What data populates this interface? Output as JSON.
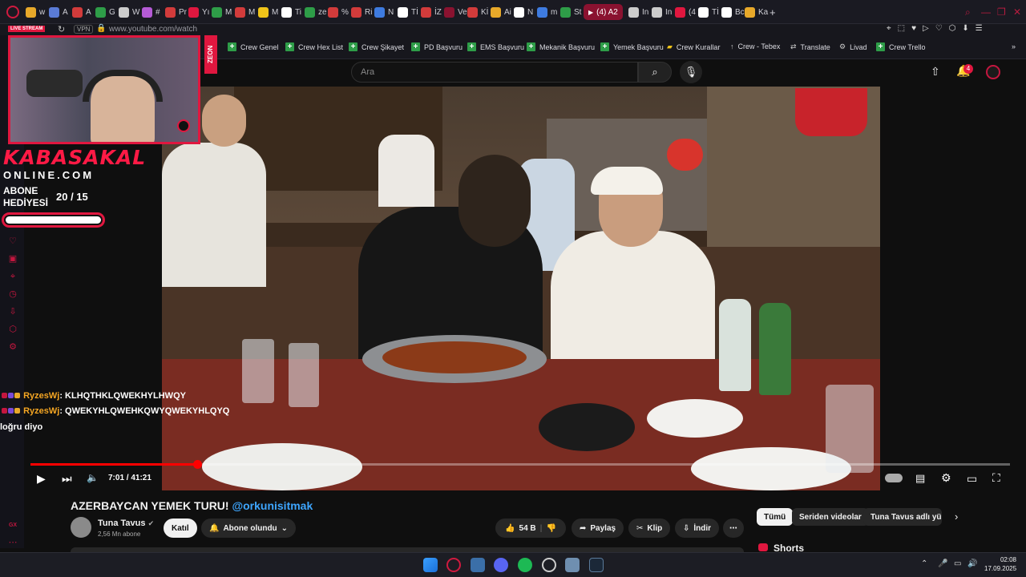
{
  "browser": {
    "tabs": [
      {
        "label": "w",
        "color": "#e8a92a"
      },
      {
        "label": "A",
        "color": "#5a7bd6"
      },
      {
        "label": "A",
        "color": "#d23b3b"
      },
      {
        "label": "G",
        "color": "#2e9d48"
      },
      {
        "label": "W",
        "color": "#cccccc"
      },
      {
        "label": "#",
        "color": "#b55bd6"
      },
      {
        "label": "Pr",
        "color": "#d23b3b"
      },
      {
        "label": "Yı",
        "color": "#e0173f"
      },
      {
        "label": "M",
        "color": "#2e9d48"
      },
      {
        "label": "M",
        "color": "#d23b3b"
      },
      {
        "label": "M",
        "color": "#f0c419"
      },
      {
        "label": "Ti",
        "color": "#ffffff"
      },
      {
        "label": "ze",
        "color": "#2e9d48"
      },
      {
        "label": "%",
        "color": "#d23b3b"
      },
      {
        "label": "Ri",
        "color": "#d23b3b"
      },
      {
        "label": "N",
        "color": "#3e7be0"
      },
      {
        "label": "Tİ",
        "color": "#ffffff"
      },
      {
        "label": "İZ",
        "color": "#d23b3b"
      },
      {
        "label": "Ve",
        "color": "#8a1230"
      },
      {
        "label": "Kİ",
        "color": "#d23b3b"
      },
      {
        "label": "Ai",
        "color": "#e8a92a"
      },
      {
        "label": "N",
        "color": "#ffffff"
      },
      {
        "label": "m",
        "color": "#3e7be0"
      },
      {
        "label": "St",
        "color": "#2e9d48"
      }
    ],
    "active_tab": "(4) A2",
    "tabs_after": [
      {
        "label": "In",
        "color": "#cccccc"
      },
      {
        "label": "In",
        "color": "#cccccc"
      },
      {
        "label": "(4",
        "color": "#e0173f"
      },
      {
        "label": "Tİ",
        "color": "#ffffff"
      },
      {
        "label": "Bc",
        "color": "#ffffff"
      },
      {
        "label": "Ka",
        "color": "#e8a92a"
      }
    ],
    "new_tab": "+",
    "url": "www.youtube.com/watch",
    "vpn_label": "VPN",
    "live_label": "LIVE STREAM",
    "bookmarks": [
      {
        "label": "Crew Genel",
        "icon": "plus"
      },
      {
        "label": "Crew Hex List",
        "icon": "plus"
      },
      {
        "label": "Crew Şikayet",
        "icon": "plus"
      },
      {
        "label": "PD Başvuru",
        "icon": "plus"
      },
      {
        "label": "EMS Başvuru",
        "icon": "plus"
      },
      {
        "label": "Mekanik Başvuru",
        "icon": "plus"
      },
      {
        "label": "Yemek Başvuru",
        "icon": "plus"
      },
      {
        "label": "Crew Kurallar",
        "icon": "folder"
      },
      {
        "label": "Crew - Tebex",
        "icon": "pin"
      },
      {
        "label": "Translate",
        "icon": "translate"
      },
      {
        "label": "Livad",
        "icon": "gear"
      },
      {
        "label": "Crew Trello",
        "icon": "plus"
      }
    ]
  },
  "youtube": {
    "search_placeholder": "Ara",
    "notification_count": "4",
    "player": {
      "time": "7:01 / 41:21",
      "progress": 0.17
    },
    "video_title": "AZERBAYCAN YEMEK TURU!",
    "video_title_tag": "@orkunisitmak",
    "channel_name": "Tuna Tavus",
    "subscribers": "2,56 Mn abone",
    "join_label": "Katıl",
    "subscribed_label": "Abone olundu",
    "likes": "54 B",
    "share_label": "Paylaş",
    "clip_label": "Klip",
    "download_label": "İndir",
    "chips": [
      "Tümü",
      "Seriden videolar",
      "Tuna Tavus adlı yükle"
    ],
    "shorts_label": "Shorts"
  },
  "overlay": {
    "logo_main": "KABASAKAL",
    "logo_sub": "ONLINE.COM",
    "goal_label": "ABONE\nHEDİYESİ",
    "goal_count": "20  / 15",
    "zeon": "ZEON",
    "chat": [
      {
        "user": "RyzesWj",
        "text": ": KLHQTHKLQWEKHYLHWQY"
      },
      {
        "user": "RyzesWj",
        "text": ": QWEKYHLQWEHKQWYQWEKYHLQYQ"
      },
      {
        "user": "",
        "text": "loğru diyo"
      }
    ]
  },
  "taskbar": {
    "time": "02:08",
    "date": "17.09.2025",
    "sidebar_label": "GX"
  }
}
